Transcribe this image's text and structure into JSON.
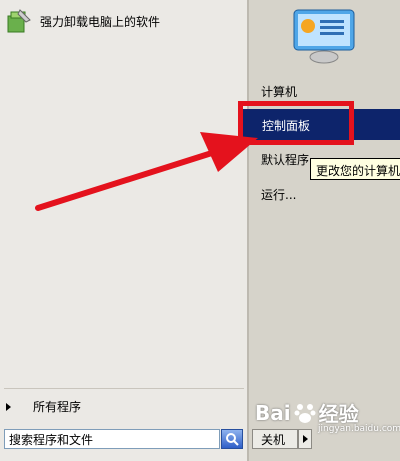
{
  "pinned": {
    "label": "强力卸载电脑上的软件"
  },
  "all_programs": {
    "label": "所有程序"
  },
  "search": {
    "value": "搜索程序和文件"
  },
  "right_menu": {
    "computer": "计算机",
    "control_panel": "控制面板",
    "default_programs": "默认程序",
    "run": "运行..."
  },
  "tooltip": {
    "text": "更改您的计算机"
  },
  "shutdown": {
    "label": "关机"
  },
  "watermark": {
    "text": "Bai",
    "text2": "经验",
    "sub": "jingyan.baidu.com"
  },
  "colors": {
    "highlight": "#0d246b",
    "annotation_red": "#e4121d"
  }
}
